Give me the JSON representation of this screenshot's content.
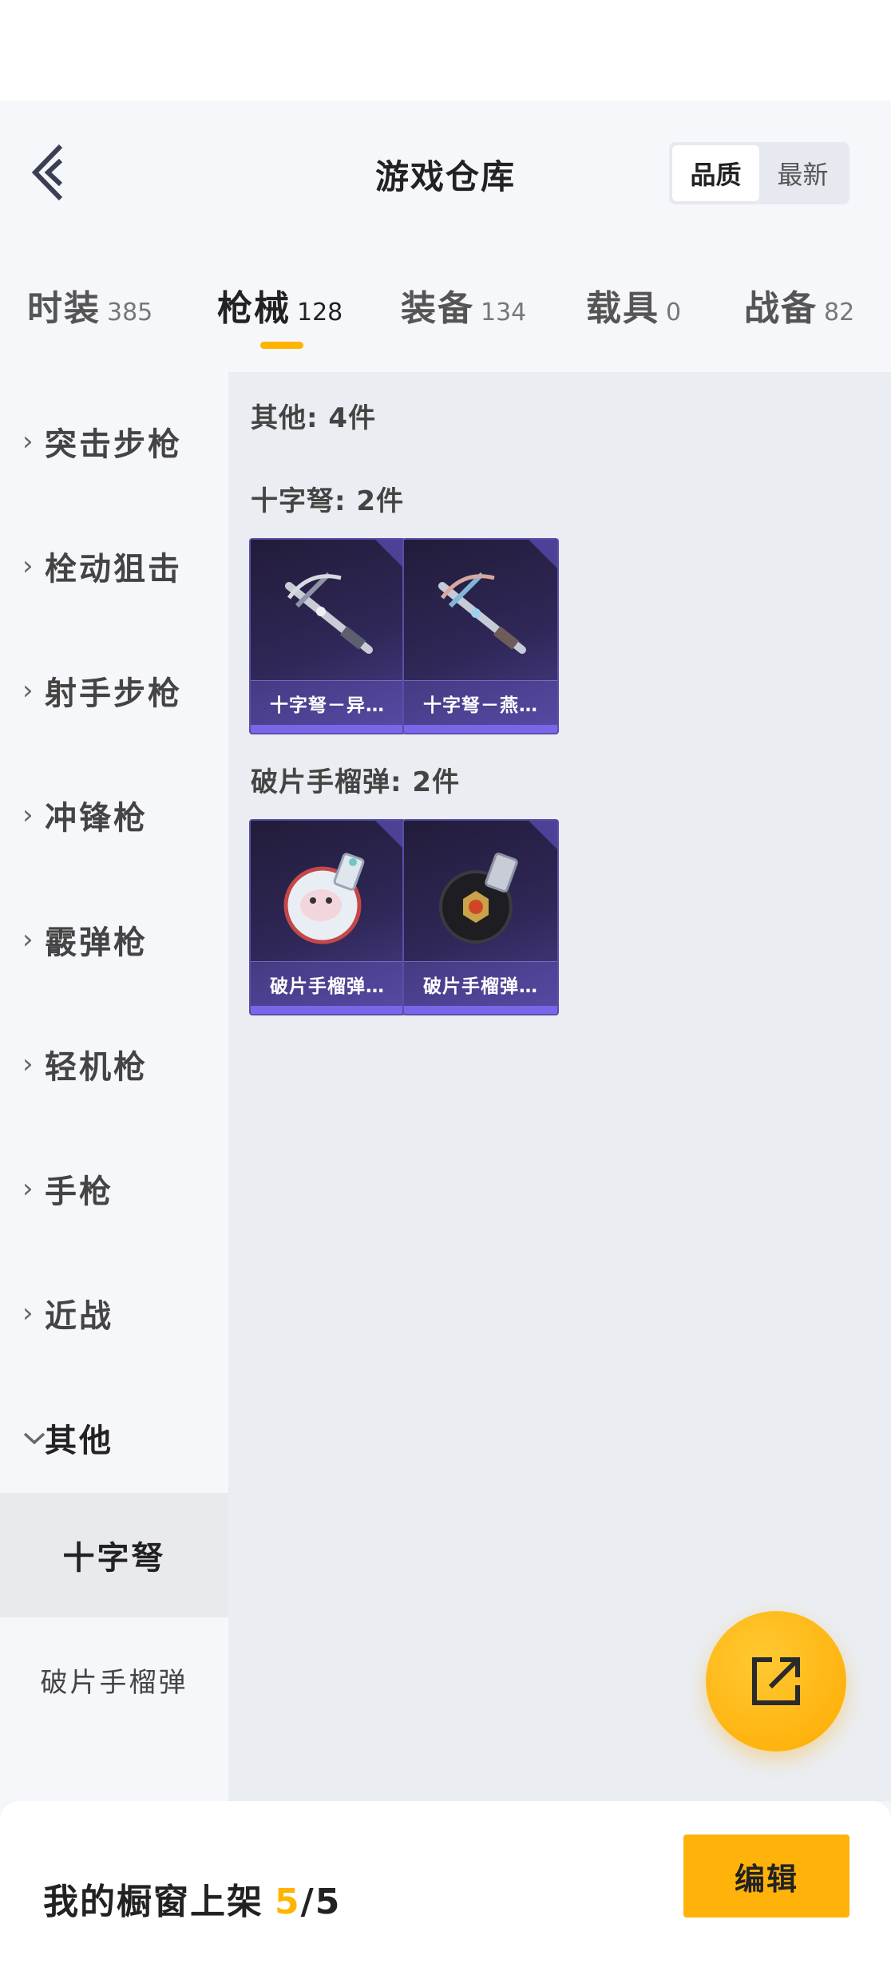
{
  "header": {
    "title": "游戏仓库",
    "sort_options": [
      "品质",
      "最新"
    ],
    "sort_selected": "品质"
  },
  "tabs": [
    {
      "label": "时装",
      "count": "385"
    },
    {
      "label": "枪械",
      "count": "128",
      "active": true
    },
    {
      "label": "装备",
      "count": "134"
    },
    {
      "label": "载具",
      "count": "0"
    },
    {
      "label": "战备",
      "count": "82"
    }
  ],
  "sidebar": {
    "categories": [
      "突击步枪",
      "栓动狙击",
      "射手步枪",
      "冲锋枪",
      "霰弹枪",
      "轻机枪",
      "手枪",
      "近战",
      "其他"
    ],
    "expanded": "其他",
    "sub_items": [
      "十字弩",
      "破片手榴弹"
    ],
    "sub_selected": "十字弩"
  },
  "content": {
    "summary": "其他: 4件",
    "groups": [
      {
        "title": "十字弩: 2件",
        "items": [
          {
            "name": "十字弩－异…",
            "icon": "crossbow-icon"
          },
          {
            "name": "十字弩－燕…",
            "icon": "crossbow-icon"
          }
        ]
      },
      {
        "title": "破片手榴弹: 2件",
        "items": [
          {
            "name": "破片手榴弹…",
            "icon": "grenade-icon"
          },
          {
            "name": "破片手榴弹…",
            "icon": "grenade-icon"
          }
        ]
      }
    ]
  },
  "fab": {
    "icon": "share-icon"
  },
  "footer": {
    "label": "我的橱窗上架",
    "count": "5",
    "separator": "/",
    "max": "5",
    "edit_label": "编辑"
  },
  "colors": {
    "accent": "#ffb400",
    "card_bg": "#2f2757",
    "card_border": "#5a4fa8"
  }
}
